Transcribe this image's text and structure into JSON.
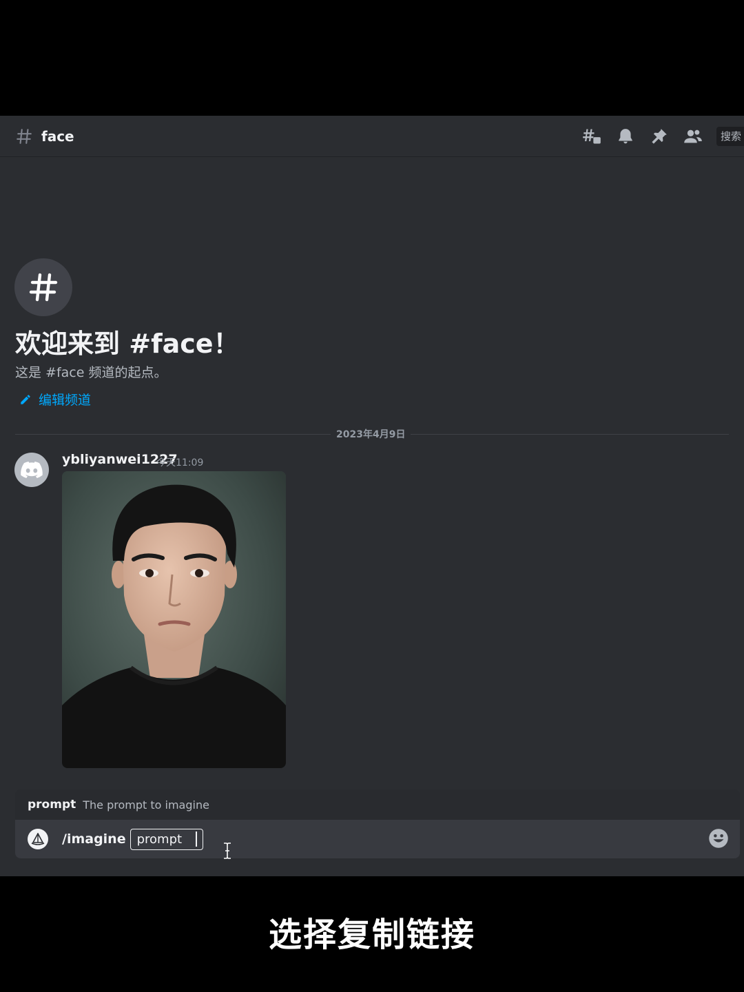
{
  "header": {
    "channel_name": "face",
    "search_placeholder": "搜索",
    "icons": [
      "threads-icon",
      "bell-icon",
      "pin-icon",
      "members-icon"
    ]
  },
  "welcome": {
    "title": "欢迎来到 #face！",
    "subtitle": "这是 #face 频道的起点。",
    "edit_link": "编辑频道"
  },
  "divider": {
    "date": "2023年4月9日"
  },
  "message": {
    "username": "ybliyanwei1227",
    "timestamp": "今天11:09",
    "attachment": "portrait-image"
  },
  "prompt_hint": {
    "name": "prompt",
    "description": "The prompt to imagine"
  },
  "input": {
    "command": "/imagine",
    "param": "prompt"
  },
  "caption": "选择复制链接",
  "colors": {
    "background": "#2b2d31",
    "header_text": "#f2f3f5",
    "link": "#00a8fc",
    "input_bg": "#383a40"
  }
}
